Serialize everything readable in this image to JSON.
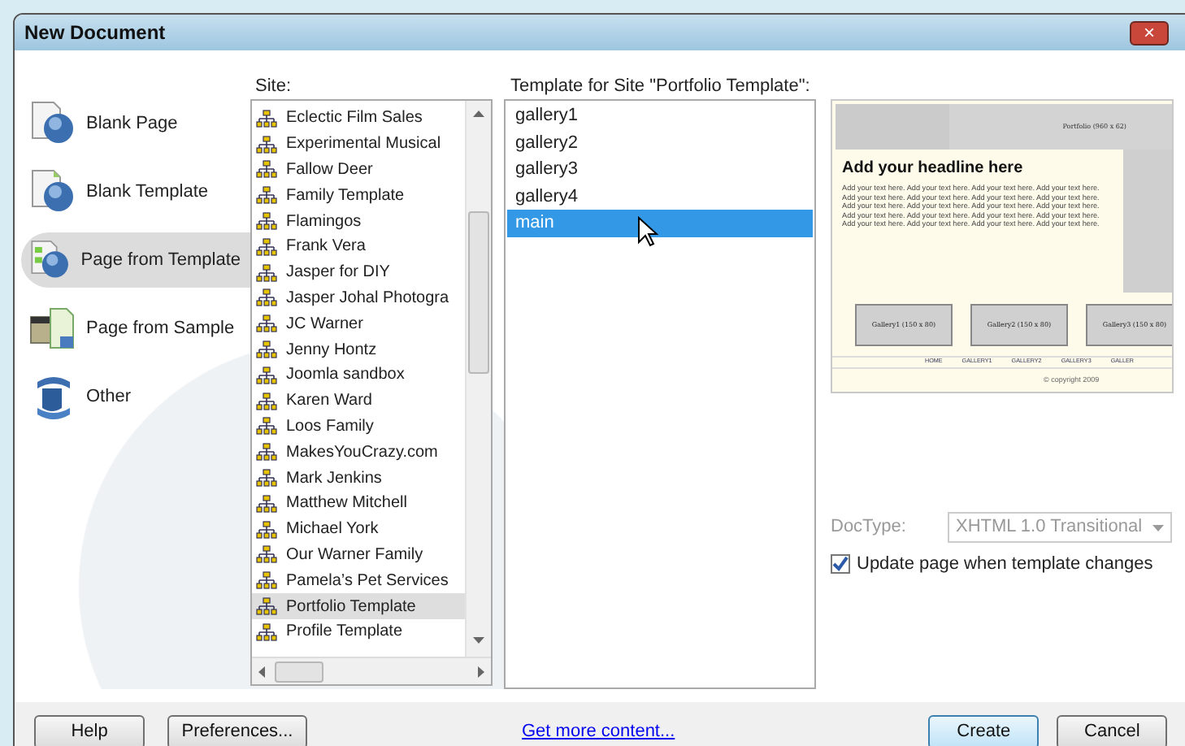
{
  "window": {
    "title": "New Document",
    "close_label": "×"
  },
  "categories": [
    {
      "label": "Blank Page",
      "kind": "blank",
      "selected": false
    },
    {
      "label": "Blank Template",
      "kind": "template",
      "selected": false
    },
    {
      "label": "Page from Template",
      "kind": "fromtemplate",
      "selected": true
    },
    {
      "label": "Page from Sample",
      "kind": "sample",
      "selected": false
    },
    {
      "label": "Other",
      "kind": "other",
      "selected": false
    }
  ],
  "site": {
    "label": "Site:",
    "items": [
      {
        "label": "Eclectic Film Sales",
        "selected": false
      },
      {
        "label": "Experimental Musical",
        "selected": false
      },
      {
        "label": "Fallow Deer",
        "selected": false
      },
      {
        "label": "Family Template",
        "selected": false
      },
      {
        "label": "Flamingos",
        "selected": false
      },
      {
        "label": "Frank Vera",
        "selected": false
      },
      {
        "label": "Jasper for DIY",
        "selected": false
      },
      {
        "label": "Jasper Johal Photogra",
        "selected": false
      },
      {
        "label": "JC Warner",
        "selected": false
      },
      {
        "label": "Jenny Hontz",
        "selected": false
      },
      {
        "label": "Joomla sandbox",
        "selected": false
      },
      {
        "label": "Karen Ward",
        "selected": false
      },
      {
        "label": "Loos Family",
        "selected": false
      },
      {
        "label": "MakesYouCrazy.com",
        "selected": false
      },
      {
        "label": "Mark Jenkins",
        "selected": false
      },
      {
        "label": "Matthew Mitchell",
        "selected": false
      },
      {
        "label": "Michael York",
        "selected": false
      },
      {
        "label": "Our Warner Family",
        "selected": false
      },
      {
        "label": "Pamela’s Pet Services",
        "selected": false
      },
      {
        "label": "Portfolio Template",
        "selected": true
      },
      {
        "label": "Profile Template",
        "selected": false
      }
    ]
  },
  "templates": {
    "label": "Template for Site \"Portfolio Template\":",
    "items": [
      {
        "label": "gallery1",
        "selected": false
      },
      {
        "label": "gallery2",
        "selected": false
      },
      {
        "label": "gallery3",
        "selected": false
      },
      {
        "label": "gallery4",
        "selected": false
      },
      {
        "label": "main",
        "selected": true
      }
    ]
  },
  "preview": {
    "banner": "Portfolio (960 x 62)",
    "headline": "Add your headline here",
    "body": "Add your text here. Add your text here. Add your text here. Add your text here. Add your text here. Add your text here. Add your text here. Add your text here. Add your text here. Add your text here. Add your text here. Add your text here. Add your text here. Add your text here. Add your text here. Add your text here. Add your text here. Add your text here. Add your text here. Add your text here.",
    "galleries": [
      "Gallery1 (150 x 80)",
      "Gallery2 (150 x 80)",
      "Gallery3 (150 x 80)"
    ],
    "nav": [
      "HOME",
      "GALLERY1",
      "GALLERY2",
      "GALLERY3",
      "GALLER"
    ],
    "footer": "© copyright 2009"
  },
  "doctype": {
    "label": "DocType:",
    "value": "XHTML 1.0 Transitional",
    "disabled": true
  },
  "update_checkbox": {
    "label": "Update page when template changes",
    "checked": true
  },
  "buttons": {
    "help": "Help",
    "preferences": "Preferences...",
    "more_link": "Get more content...",
    "create": "Create",
    "cancel": "Cancel"
  }
}
